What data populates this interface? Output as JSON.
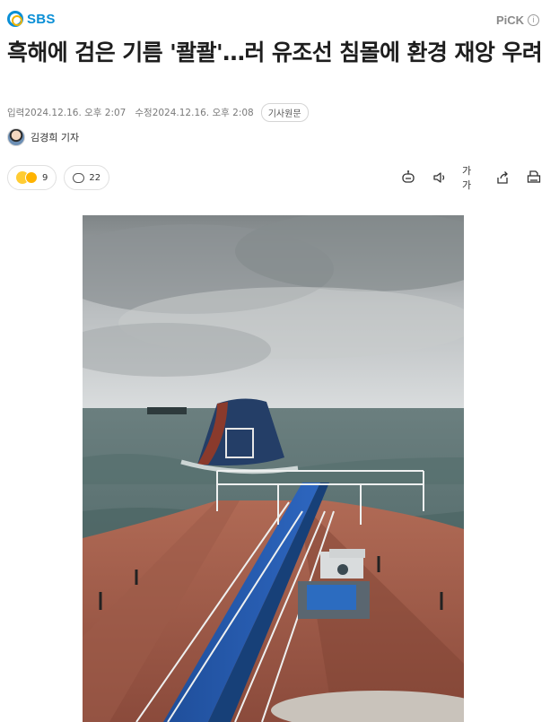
{
  "header": {
    "logo_text": "SBS",
    "pick_label": "PiCK",
    "pick_info_icon": "info-icon"
  },
  "article": {
    "headline": "흑해에 검은 기름 '콸콸'…러 유조선 침몰에 환경 재앙 우려",
    "input_label": "입력",
    "input_time": "2024.12.16. 오후 2:07",
    "edit_label": "수정",
    "edit_time": "2024.12.16. 오후 2:08",
    "original_button": "기사원문",
    "reporter": "김경희 기자"
  },
  "reactions": {
    "emoji_count": "9",
    "comment_count": "22"
  },
  "toolbar": {
    "summary_icon": "robot-summary-icon",
    "audio_icon": "speaker-icon",
    "font_label": "가가",
    "share_icon": "share-icon",
    "print_icon": "print-icon"
  },
  "colors": {
    "brand": "#0a8fd6",
    "brand_secondary": "#f0b400",
    "text": "#1e1e1e",
    "meta": "#7a7a7a"
  }
}
